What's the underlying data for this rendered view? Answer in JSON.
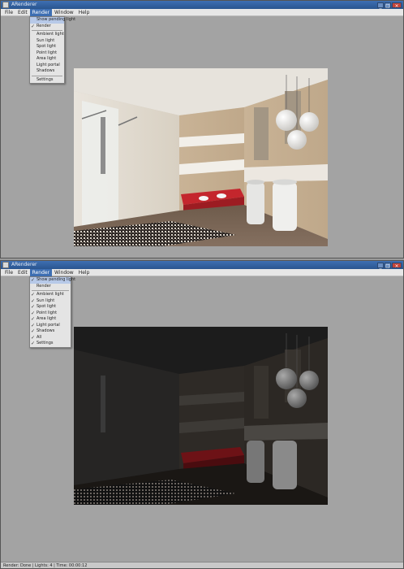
{
  "window_top": {
    "title": "ARenderer",
    "menu": [
      "File",
      "Edit",
      "Render",
      "Window",
      "Help"
    ],
    "active_menu": "Render",
    "dropdown": {
      "header": "Show pending light",
      "items": [
        "Render",
        "Ambient light",
        "Sun light",
        "Spot light",
        "Point light",
        "Area light",
        "Light portal",
        "Shadows"
      ],
      "footer": "Settings"
    }
  },
  "window_bottom": {
    "title": "ARenderer",
    "menu": [
      "File",
      "Edit",
      "Render",
      "Window",
      "Help"
    ],
    "active_menu": "Render",
    "dropdown": {
      "header": "Show pending light",
      "sub": "Render",
      "items": [
        "Ambient light",
        "Sun light",
        "Spot light",
        "Point light",
        "Area light",
        "Light portal",
        "Shadows",
        "All",
        "Settings"
      ]
    },
    "status": "Render: Done  |  Lights: 4  |  Time: 00:00:12"
  },
  "colors": {
    "accent": "#3e6fb3",
    "panel": "#a3a3a3"
  }
}
